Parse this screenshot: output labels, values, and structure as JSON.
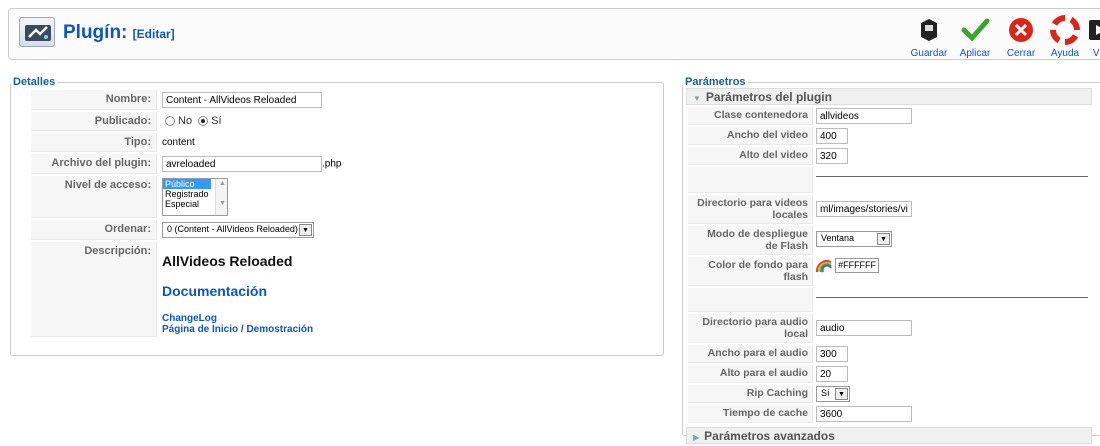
{
  "header": {
    "title": "Plugín:",
    "action": "[Editar]"
  },
  "toolbar": {
    "guardar": "Guardar",
    "aplicar": "Aplicar",
    "cerrar": "Cerrar",
    "ayuda": "Ayuda",
    "video": "Vid"
  },
  "details": {
    "legend": "Detalles",
    "nombre_label": "Nombre:",
    "nombre_value": "Content - AllVideos Reloaded",
    "publicado_label": "Publicado:",
    "no_label": "No",
    "si_label": "Sí",
    "tipo_label": "Tipo:",
    "tipo_value": "content",
    "archivo_label": "Archivo del plugin:",
    "archivo_value": "avreloaded",
    "archivo_ext": ".php",
    "acceso_label": "Nivel de acceso:",
    "acceso_options": [
      "Público",
      "Registrado",
      "Especial"
    ],
    "ordenar_label": "Ordenar:",
    "ordenar_value": "0 (Content - AllVideos Reloaded)",
    "descripcion_label": "Descripción:",
    "desc_title": "AllVideos Reloaded",
    "desc_doc": "Documentación",
    "desc_changelog": "ChangeLog",
    "desc_home": "Página de Inicio / Demostración"
  },
  "params": {
    "legend": "Parámetros",
    "section1": "Parámetros del plugin",
    "section2": "Parámetros avanzados",
    "clase_label": "Clase contenedora",
    "clase_value": "allvideos",
    "ancho_video_label": "Ancho del video",
    "ancho_video_value": "400",
    "alto_video_label": "Alto del video",
    "alto_video_value": "320",
    "dir_videos_label": "Directorio para videos locales",
    "dir_videos_value": "ml/images/stories/videos",
    "modo_flash_label": "Modo de despliegue de Flash",
    "modo_flash_value": "Ventana",
    "color_fondo_label": "Color de fondo para flash",
    "color_fondo_value": "#FFFFFF",
    "dir_audio_label": "Directorio para audio local",
    "dir_audio_value": "audio",
    "ancho_audio_label": "Ancho para el audio",
    "ancho_audio_value": "300",
    "alto_audio_label": "Alto para el audio",
    "alto_audio_value": "20",
    "rip_label": "Rip Caching",
    "rip_value": "Sí",
    "cache_label": "Tiempo de cache",
    "cache_value": "3600"
  },
  "colors": {
    "link": "#0b55c4",
    "legend": "#146295",
    "selected": "#3399ff"
  }
}
